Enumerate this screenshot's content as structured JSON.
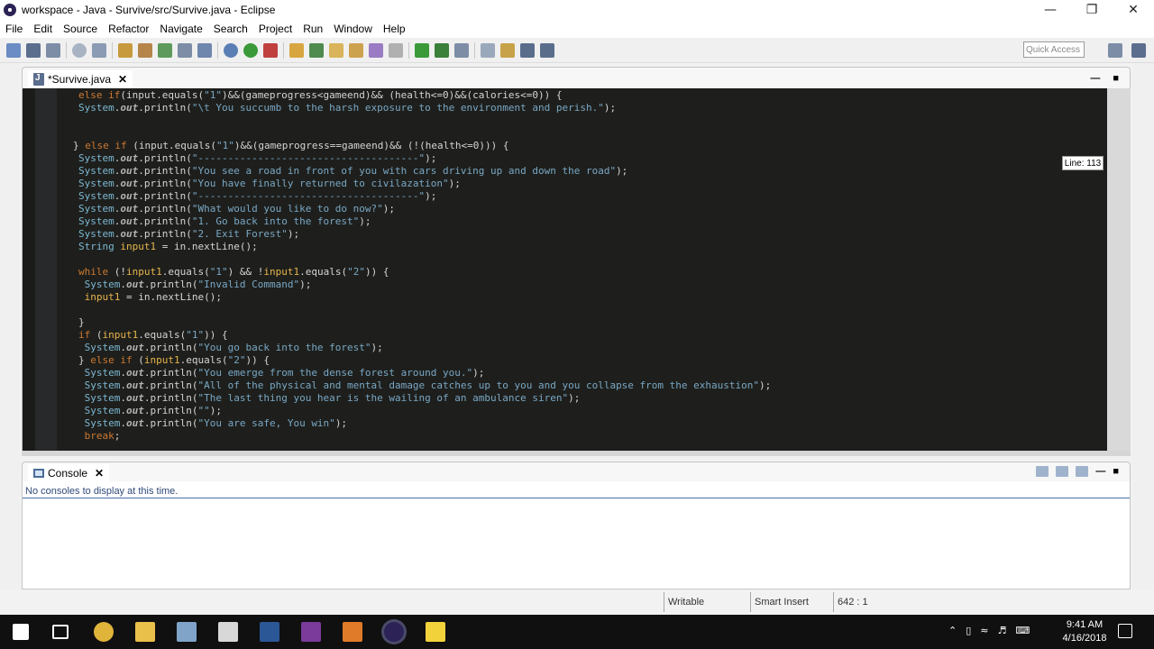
{
  "window": {
    "title": "workspace - Java - Survive/src/Survive.java - Eclipse",
    "minimize": "—",
    "restore": "❐",
    "close": "✕"
  },
  "menu": [
    "File",
    "Edit",
    "Source",
    "Refactor",
    "Navigate",
    "Search",
    "Project",
    "Run",
    "Window",
    "Help"
  ],
  "toolbar": {
    "quick_access_placeholder": "Quick Access"
  },
  "editor": {
    "tab_label": "*Survive.java",
    "tab_close": "✕",
    "line_badge": "Line: 113",
    "code_lines": [
      [
        [
          "kw",
          "else if"
        ],
        [
          "pl",
          "(input.equals("
        ],
        [
          "str",
          "\"1\""
        ],
        [
          "pl",
          ")&&(gameprogress<gameend)&& (health<=0)&&(calories<=0)) {"
        ]
      ],
      [
        [
          "cls",
          "System"
        ],
        [
          "pl",
          "."
        ],
        [
          "fld",
          "out"
        ],
        [
          "pl",
          ".println("
        ],
        [
          "str",
          "\"\\t You succumb to the harsh exposure to the environment and perish.\""
        ],
        [
          "pl",
          ");"
        ]
      ],
      [],
      [],
      [
        [
          "pl",
          "} "
        ],
        [
          "kw",
          "else if"
        ],
        [
          "pl",
          " (input.equals("
        ],
        [
          "str",
          "\"1\""
        ],
        [
          "pl",
          ")&&(gameprogress==gameend)&& (!(health<=0))) {"
        ]
      ],
      [
        [
          "cls",
          "System"
        ],
        [
          "pl",
          "."
        ],
        [
          "fld",
          "out"
        ],
        [
          "pl",
          ".println("
        ],
        [
          "str",
          "\"-------------------------------------\""
        ],
        [
          "pl",
          ");"
        ]
      ],
      [
        [
          "cls",
          "System"
        ],
        [
          "pl",
          "."
        ],
        [
          "fld",
          "out"
        ],
        [
          "pl",
          ".println("
        ],
        [
          "str",
          "\"You see a road in front of you with cars driving up and down the road\""
        ],
        [
          "pl",
          ");"
        ]
      ],
      [
        [
          "cls",
          "System"
        ],
        [
          "pl",
          "."
        ],
        [
          "fld",
          "out"
        ],
        [
          "pl",
          ".println("
        ],
        [
          "str",
          "\"You have finally returned to civilazation\""
        ],
        [
          "pl",
          ");"
        ]
      ],
      [
        [
          "cls",
          "System"
        ],
        [
          "pl",
          "."
        ],
        [
          "fld",
          "out"
        ],
        [
          "pl",
          ".println("
        ],
        [
          "str",
          "\"-------------------------------------\""
        ],
        [
          "pl",
          ");"
        ]
      ],
      [
        [
          "cls",
          "System"
        ],
        [
          "pl",
          "."
        ],
        [
          "fld",
          "out"
        ],
        [
          "pl",
          ".println("
        ],
        [
          "str",
          "\"What would you like to do now?\""
        ],
        [
          "pl",
          ");"
        ]
      ],
      [
        [
          "cls",
          "System"
        ],
        [
          "pl",
          "."
        ],
        [
          "fld",
          "out"
        ],
        [
          "pl",
          ".println("
        ],
        [
          "str",
          "\"1. Go back into the forest\""
        ],
        [
          "pl",
          ");"
        ]
      ],
      [
        [
          "cls",
          "System"
        ],
        [
          "pl",
          "."
        ],
        [
          "fld",
          "out"
        ],
        [
          "pl",
          ".println("
        ],
        [
          "str",
          "\"2. Exit Forest\""
        ],
        [
          "pl",
          ");"
        ]
      ],
      [
        [
          "cls",
          "String"
        ],
        [
          "pl",
          " "
        ],
        [
          "var",
          "input1"
        ],
        [
          "pl",
          " = in.nextLine();"
        ]
      ],
      [],
      [
        [
          "kw",
          "while"
        ],
        [
          "pl",
          " (!"
        ],
        [
          "var",
          "input1"
        ],
        [
          "pl",
          ".equals("
        ],
        [
          "str",
          "\"1\""
        ],
        [
          "pl",
          ") && !"
        ],
        [
          "var",
          "input1"
        ],
        [
          "pl",
          ".equals("
        ],
        [
          "str",
          "\"2\""
        ],
        [
          "pl",
          ")) {"
        ]
      ],
      [
        [
          "pl",
          " "
        ],
        [
          "cls",
          "System"
        ],
        [
          "pl",
          "."
        ],
        [
          "fld",
          "out"
        ],
        [
          "pl",
          ".println("
        ],
        [
          "str",
          "\"Invalid Command\""
        ],
        [
          "pl",
          ");"
        ]
      ],
      [
        [
          "pl",
          " "
        ],
        [
          "var",
          "input1"
        ],
        [
          "pl",
          " = in.nextLine();"
        ]
      ],
      [],
      [
        [
          "pl",
          "}"
        ]
      ],
      [
        [
          "kw",
          "if"
        ],
        [
          "pl",
          " ("
        ],
        [
          "var",
          "input1"
        ],
        [
          "pl",
          ".equals("
        ],
        [
          "str",
          "\"1\""
        ],
        [
          "pl",
          ")) {"
        ]
      ],
      [
        [
          "pl",
          " "
        ],
        [
          "cls",
          "System"
        ],
        [
          "pl",
          "."
        ],
        [
          "fld",
          "out"
        ],
        [
          "pl",
          ".println("
        ],
        [
          "str",
          "\"You go back into the forest\""
        ],
        [
          "pl",
          ");"
        ]
      ],
      [
        [
          "pl",
          "} "
        ],
        [
          "kw",
          "else if"
        ],
        [
          "pl",
          " ("
        ],
        [
          "var",
          "input1"
        ],
        [
          "pl",
          ".equals("
        ],
        [
          "str",
          "\"2\""
        ],
        [
          "pl",
          ")) {"
        ]
      ],
      [
        [
          "pl",
          " "
        ],
        [
          "cls",
          "System"
        ],
        [
          "pl",
          "."
        ],
        [
          "fld",
          "out"
        ],
        [
          "pl",
          ".println("
        ],
        [
          "str",
          "\"You emerge from the dense forest around you.\""
        ],
        [
          "pl",
          ");"
        ]
      ],
      [
        [
          "pl",
          " "
        ],
        [
          "cls",
          "System"
        ],
        [
          "pl",
          "."
        ],
        [
          "fld",
          "out"
        ],
        [
          "pl",
          ".println("
        ],
        [
          "str",
          "\"All of the physical and mental damage catches up to you and you collapse from the exhaustion\""
        ],
        [
          "pl",
          ");"
        ]
      ],
      [
        [
          "pl",
          " "
        ],
        [
          "cls",
          "System"
        ],
        [
          "pl",
          "."
        ],
        [
          "fld",
          "out"
        ],
        [
          "pl",
          ".println("
        ],
        [
          "str",
          "\"The last thing you hear is the wailing of an ambulance siren\""
        ],
        [
          "pl",
          ");"
        ]
      ],
      [
        [
          "pl",
          " "
        ],
        [
          "cls",
          "System"
        ],
        [
          "pl",
          "."
        ],
        [
          "fld",
          "out"
        ],
        [
          "pl",
          ".println("
        ],
        [
          "str",
          "\"\""
        ],
        [
          "pl",
          ");"
        ]
      ],
      [
        [
          "pl",
          " "
        ],
        [
          "cls",
          "System"
        ],
        [
          "pl",
          "."
        ],
        [
          "fld",
          "out"
        ],
        [
          "pl",
          ".println("
        ],
        [
          "str",
          "\"You are safe, You win\""
        ],
        [
          "pl",
          ");"
        ]
      ],
      [
        [
          "pl",
          " "
        ],
        [
          "kw",
          "break"
        ],
        [
          "pl",
          ";"
        ]
      ]
    ]
  },
  "console": {
    "tab_label": "Console",
    "tab_close": "✕",
    "message": "No consoles to display at this time."
  },
  "status": {
    "writable": "Writable",
    "insert_mode": "Smart Insert",
    "position": "642 : 1"
  },
  "taskbar": {
    "time": "9:41 AM",
    "date": "4/16/2018"
  },
  "colors": {
    "editor_bg": "#1e1f1c",
    "keyword": "#cc7832",
    "string": "#79a7c5",
    "variable": "#e6b44c"
  }
}
